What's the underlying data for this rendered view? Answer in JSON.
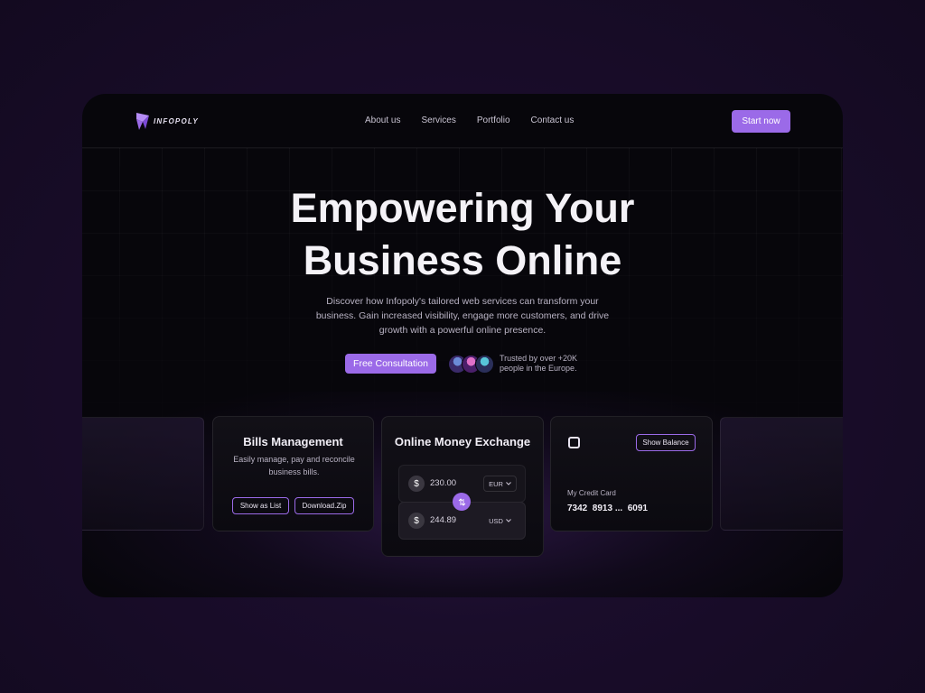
{
  "brand": {
    "name": "INFOPOLY"
  },
  "nav": {
    "links": [
      "About us",
      "Services",
      "Portfolio",
      "Contact us"
    ],
    "cta": "Start now"
  },
  "hero": {
    "title_line1": "Empowering Your",
    "title_line2": "Business Online",
    "subtitle": "Discover how Infopoly's tailored web services can transform your business. Gain increased visibility, engage more customers, and drive growth with a powerful online presence.",
    "cta": "Free Consultation",
    "trust_line1": "Trusted by over +20K",
    "trust_line2": "people in the Europe."
  },
  "bills_card": {
    "title": "Bills Management",
    "description": "Easily manage, pay and reconcile business bills.",
    "btn_list": "Show as List",
    "btn_download": "Download.Zip"
  },
  "exchange_card": {
    "title": "Online Money Exchange",
    "from_symbol": "$",
    "from_amount": "230.00",
    "from_currency": "EUR",
    "to_symbol": "$",
    "to_amount": "244.89",
    "to_currency": "USD"
  },
  "credit_card": {
    "show_balance": "Show Balance",
    "label": "My Credit Card",
    "number": "7342  8913 ...  6091"
  },
  "colors": {
    "accent": "#9b6ae8",
    "background": "#07060b",
    "page_bg": "#1a0d2b"
  },
  "icons": [
    "logo-icon",
    "dollar-icon",
    "chevron-down-icon",
    "swap-icon",
    "card-chip-icon"
  ]
}
